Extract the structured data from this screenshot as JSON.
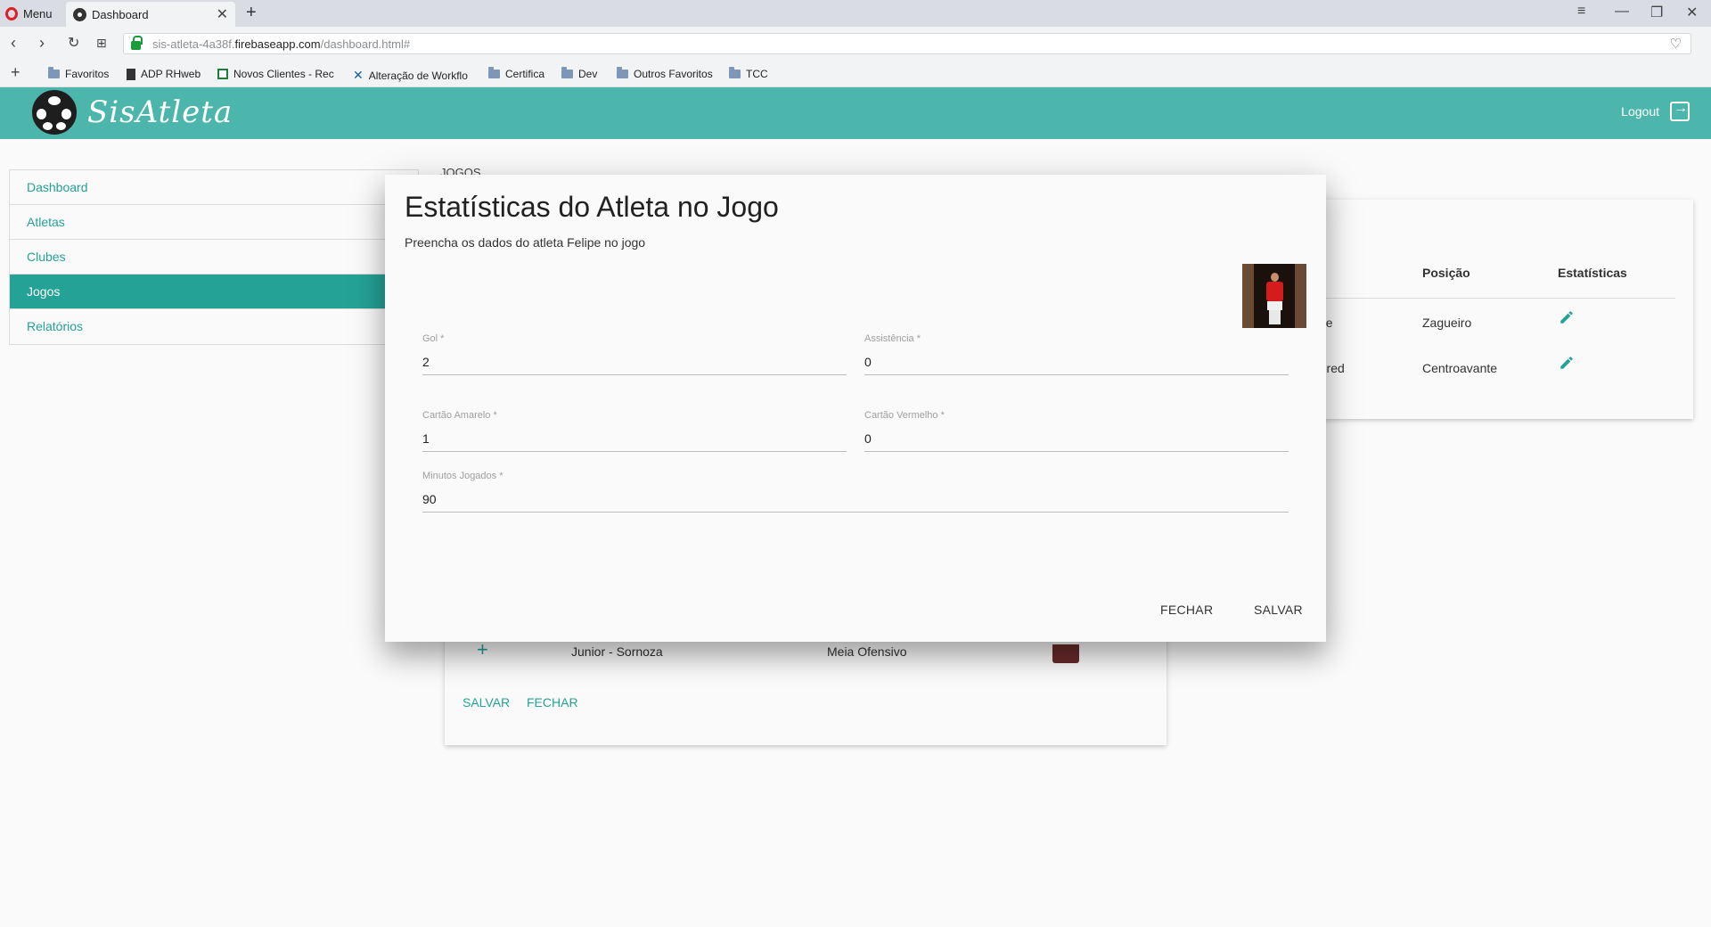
{
  "browser": {
    "menu_label": "Menu",
    "tab_title": "Dashboard",
    "url_prefix": "sis-atleta-4a38f.",
    "url_host": "firebaseapp.com",
    "url_path": "/dashboard.html#",
    "bookmarks": [
      "Favoritos",
      "ADP RHweb",
      "Novos Clientes - Rec",
      "Alteração de Workflo",
      "Certifica",
      "Dev",
      "Outros Favoritos",
      "TCC"
    ]
  },
  "app": {
    "logo_text": "SisAtleta",
    "logout_label": "Logout",
    "brand_color": "#4db6ac",
    "accent_color": "#26a69a"
  },
  "sidebar": {
    "items": [
      {
        "label": "Dashboard",
        "active": false
      },
      {
        "label": "Atletas",
        "active": false
      },
      {
        "label": "Clubes",
        "active": false
      },
      {
        "label": "Jogos",
        "active": true
      },
      {
        "label": "Relatórios",
        "active": false
      }
    ]
  },
  "background": {
    "section_heading": "JOGOS",
    "table": {
      "headers": {
        "posicao": "Posição",
        "estatisticas": "Estatísticas"
      },
      "rows": [
        {
          "name": "pe",
          "position": "Zagueiro",
          "action_icon": "edit-icon"
        },
        {
          "name": "Fred",
          "position": "Centroavante",
          "action_icon": "edit-icon"
        }
      ]
    },
    "candidate": {
      "name": "Junior - Sornoza",
      "position": "Meia Ofensivo",
      "add_icon": "plus-icon"
    },
    "save_label": "SALVAR",
    "close_label": "FECHAR"
  },
  "modal": {
    "title": "Estatísticas do Atleta no Jogo",
    "subtitle": "Preencha os dados do atleta Felipe no jogo",
    "fields": {
      "gol": {
        "label": "Gol *",
        "value": "2"
      },
      "assistencia": {
        "label": "Assistência *",
        "value": "0"
      },
      "cartao_amarelo": {
        "label": "Cartão Amarelo *",
        "value": "1"
      },
      "cartao_vermelho": {
        "label": "Cartão Vermelho *",
        "value": "0"
      },
      "minutos": {
        "label": "Minutos Jogados *",
        "value": "90"
      }
    },
    "close_label": "FECHAR",
    "save_label": "SALVAR"
  }
}
